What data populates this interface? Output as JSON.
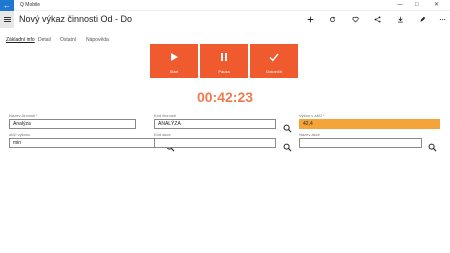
{
  "window": {
    "app_title": "Q Mobile",
    "back_icon": "back-arrow-icon",
    "controls": [
      "minimize-icon",
      "maximize-icon",
      "close-icon"
    ]
  },
  "appbar": {
    "title": "Nový výkaz činnosti Od - Do",
    "actions": [
      "add-icon",
      "refresh-icon",
      "favorite-icon",
      "share-icon",
      "download-icon",
      "edit-icon",
      "more-icon"
    ]
  },
  "tabs": [
    {
      "label": "Základní info",
      "active": true
    },
    {
      "label": "Detail",
      "active": false
    },
    {
      "label": "Ostatní",
      "active": false
    },
    {
      "label": "Nápověda",
      "active": false
    }
  ],
  "actions": {
    "start_label": "Start",
    "pause_label": "Pauza",
    "finish_label": "Dokončit",
    "color": "#ef5b2e"
  },
  "timer": "00:42:23",
  "fields": {
    "nazev_cinnosti": {
      "label": "Název činnosti *",
      "value": "Analýza"
    },
    "kod_cinnosti": {
      "label": "Kód činnosti",
      "value": "ANALÝZA"
    },
    "vykon": {
      "label": "Výkon v aMJ *",
      "value": "42,4"
    },
    "amj_vykonu": {
      "label": "aMJ výkonu",
      "value": "min"
    },
    "kod_akce": {
      "label": "Kód akce",
      "value": ""
    },
    "nazev_akce": {
      "label": "Název akce",
      "value": ""
    }
  },
  "colors": {
    "accent": "#ef5b2e",
    "timer": "#ef7a4e",
    "highlight_field": "#f5a43a",
    "back_button": "#1e78d2"
  }
}
